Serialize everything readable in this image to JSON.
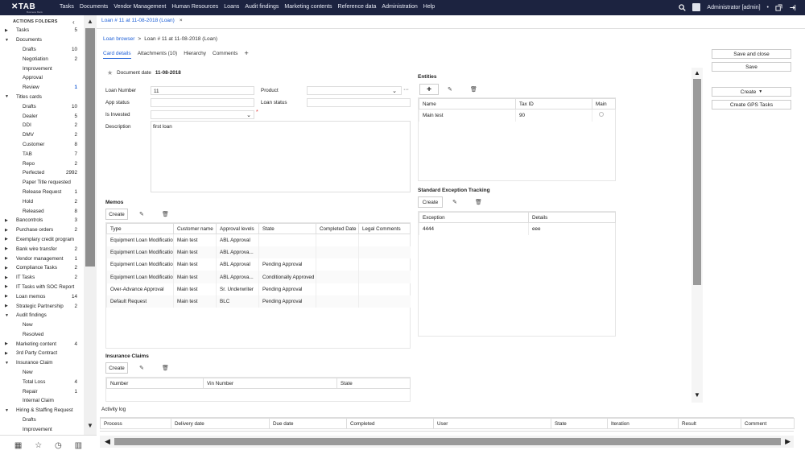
{
  "topbar": {
    "logo": "TAB",
    "logo_sub": "Business Bank",
    "nav": [
      "Tasks",
      "Documents",
      "Vendor Management",
      "Human Resources",
      "Loans",
      "Audit findings",
      "Marketing contents",
      "Reference data",
      "Administration",
      "Help"
    ],
    "user": "Administrator [admin]"
  },
  "sidebar": {
    "header": "ACTIONS FOLDERS",
    "items": [
      {
        "label": "Tasks",
        "count": "5",
        "level": 0,
        "arrow": "right"
      },
      {
        "label": "Documents",
        "count": "",
        "level": 0,
        "arrow": "down"
      },
      {
        "label": "Drafts",
        "count": "10",
        "level": 1
      },
      {
        "label": "Negotiation",
        "count": "2",
        "level": 1
      },
      {
        "label": "Improvement",
        "count": "",
        "level": 1
      },
      {
        "label": "Approval",
        "count": "",
        "level": 1
      },
      {
        "label": "Review",
        "count": "1",
        "level": 1,
        "highlight": true
      },
      {
        "label": "Titles cards",
        "count": "",
        "level": 0,
        "arrow": "down"
      },
      {
        "label": "Drafts",
        "count": "10",
        "level": 1
      },
      {
        "label": "Dealer",
        "count": "5",
        "level": 1
      },
      {
        "label": "DDI",
        "count": "2",
        "level": 1
      },
      {
        "label": "DMV",
        "count": "2",
        "level": 1
      },
      {
        "label": "Customer",
        "count": "8",
        "level": 1
      },
      {
        "label": "TAB",
        "count": "7",
        "level": 1
      },
      {
        "label": "Repo",
        "count": "2",
        "level": 1
      },
      {
        "label": "Perfected",
        "count": "2992",
        "level": 1
      },
      {
        "label": "Paper Title requested",
        "count": "",
        "level": 1
      },
      {
        "label": "Release Request",
        "count": "1",
        "level": 1
      },
      {
        "label": "Hold",
        "count": "2",
        "level": 1
      },
      {
        "label": "Released",
        "count": "8",
        "level": 1
      },
      {
        "label": "Bancontrols",
        "count": "3",
        "level": 0,
        "arrow": "right"
      },
      {
        "label": "Purchase orders",
        "count": "2",
        "level": 0,
        "arrow": "right"
      },
      {
        "label": "Exemplary credit program",
        "count": "",
        "level": 0,
        "arrow": "right"
      },
      {
        "label": "Bank wire transfer",
        "count": "2",
        "level": 0,
        "arrow": "right"
      },
      {
        "label": "Vendor management",
        "count": "1",
        "level": 0,
        "arrow": "right"
      },
      {
        "label": "Compliance Tasks",
        "count": "2",
        "level": 0,
        "arrow": "right"
      },
      {
        "label": "IT Tasks",
        "count": "2",
        "level": 0,
        "arrow": "right"
      },
      {
        "label": "IT Tasks with SOC Report",
        "count": "",
        "level": 0,
        "arrow": "right"
      },
      {
        "label": "Loan memos",
        "count": "14",
        "level": 0,
        "arrow": "right"
      },
      {
        "label": "Strategic Partnership",
        "count": "2",
        "level": 0,
        "arrow": "right"
      },
      {
        "label": "Audit findings",
        "count": "",
        "level": 0,
        "arrow": "down"
      },
      {
        "label": "New",
        "count": "",
        "level": 1
      },
      {
        "label": "Resolved",
        "count": "",
        "level": 1
      },
      {
        "label": "Marketing content",
        "count": "4",
        "level": 0,
        "arrow": "right"
      },
      {
        "label": "3rd Party Contract",
        "count": "",
        "level": 0,
        "arrow": "right"
      },
      {
        "label": "Insurance Claim",
        "count": "",
        "level": 0,
        "arrow": "down"
      },
      {
        "label": "New",
        "count": "",
        "level": 1
      },
      {
        "label": "Total Loss",
        "count": "4",
        "level": 1
      },
      {
        "label": "Repair",
        "count": "1",
        "level": 1
      },
      {
        "label": "Internal Claim",
        "count": "",
        "level": 1
      },
      {
        "label": "Hiring & Staffing Request",
        "count": "",
        "level": 0,
        "arrow": "down"
      },
      {
        "label": "Drafts",
        "count": "",
        "level": 1
      },
      {
        "label": "Improvement",
        "count": "",
        "level": 1
      }
    ]
  },
  "tab": {
    "label": "Loan # 11 at 11-08-2018 (Loan)"
  },
  "breadcrumb": {
    "root": "Loan browser",
    "sep": ">",
    "current": "Loan # 11 at 11-08-2018 (Loan)"
  },
  "subtabs": [
    "Card details",
    "Attachments (10)",
    "Hierarchy",
    "Comments"
  ],
  "doc_date": {
    "label": "Document date",
    "value": "11-08-2018"
  },
  "form": {
    "loan_number_label": "Loan Number",
    "loan_number": "11",
    "product_label": "Product",
    "app_status_label": "App status",
    "loan_status_label": "Loan status",
    "is_invested_label": "Is Invested",
    "description_label": "Description",
    "description": "first loan"
  },
  "memos": {
    "title": "Memos",
    "create": "Create",
    "columns": [
      "Type",
      "Customer name",
      "Approval levels",
      "State",
      "Completed Date",
      "Legal Comments"
    ],
    "rows": [
      [
        "Equipment Loan Modification",
        "Main test",
        "ABL Approval",
        "",
        "",
        ""
      ],
      [
        "Equipment Loan Modification",
        "Main test",
        "ABL Approva...",
        "",
        "",
        ""
      ],
      [
        "Equipment Loan Modification",
        "Main test",
        "ABL Approval",
        "Pending Approval",
        "",
        ""
      ],
      [
        "Equipment Loan Modification",
        "Main test",
        "ABL Approva...",
        "Conditionally Approved",
        "",
        ""
      ],
      [
        "Over-Advance Approval",
        "Main test",
        "Sr. Underwriter",
        "Pending Approval",
        "",
        ""
      ],
      [
        "Default Request",
        "Main test",
        "BLC",
        "Pending Approval",
        "",
        ""
      ]
    ]
  },
  "insurance": {
    "title": "Insurance Claims",
    "create": "Create",
    "columns": [
      "Number",
      "Vin Number",
      "State"
    ]
  },
  "entities": {
    "title": "Entities",
    "columns": [
      "Name",
      "Tax ID",
      "Main"
    ],
    "rows": [
      [
        "Main test",
        "90",
        ""
      ]
    ]
  },
  "exceptions": {
    "title": "Standard Exception Tracking",
    "create": "Create",
    "columns": [
      "Exception",
      "Details"
    ],
    "rows": [
      [
        "4444",
        "eee"
      ]
    ]
  },
  "actions": {
    "save_close": "Save and close",
    "save": "Save",
    "create": "Create",
    "create_gps": "Create GPS Tasks"
  },
  "activity": {
    "title": "Activity log",
    "columns": [
      "Process",
      "Delivery date",
      "Due date",
      "Completed",
      "User",
      "State",
      "Iteration",
      "Result",
      "Comment"
    ]
  }
}
